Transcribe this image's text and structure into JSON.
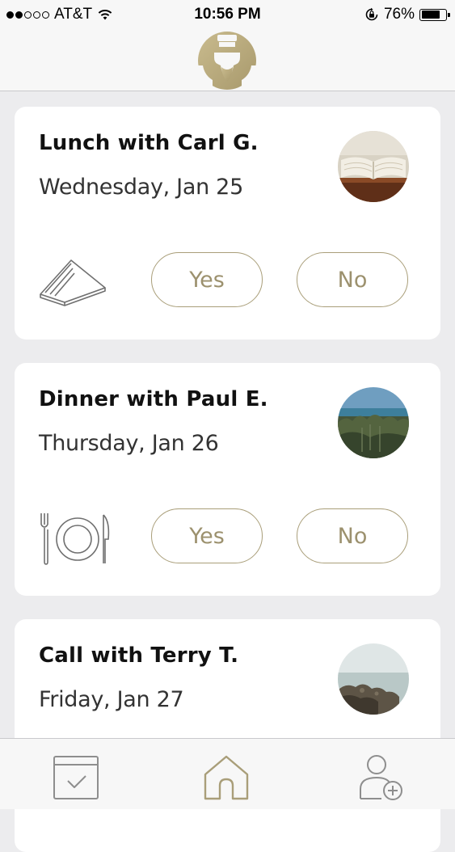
{
  "status_bar": {
    "carrier": "AT&T",
    "time": "10:56 PM",
    "battery": "76%",
    "battery_level": 0.76,
    "signal_bars": 2,
    "signal_total": 5,
    "icons": [
      "wifi-icon",
      "rotation-lock-icon",
      "battery-icon"
    ]
  },
  "header": {
    "logo_icon": "butler-logo",
    "logo_color": "#b4a67b"
  },
  "events": [
    {
      "title": "Lunch with Carl G.",
      "date": "Wednesday, Jan 25",
      "meal_icon": "sandwich-icon",
      "avatar": "book-photo",
      "yes_label": "Yes",
      "no_label": "No"
    },
    {
      "title": "Dinner with Paul E.",
      "date": "Thursday, Jan 26",
      "meal_icon": "plate-fork-knife-icon",
      "avatar": "coast-photo",
      "yes_label": "Yes",
      "no_label": "No"
    },
    {
      "title": "Call with Terry T.",
      "date": "Friday, Jan 27",
      "avatar": "rocks-sea-photo"
    }
  ],
  "tab_bar": {
    "tabs": [
      {
        "icon": "calendar-check-icon",
        "active": false
      },
      {
        "icon": "home-icon",
        "active": true
      },
      {
        "icon": "add-user-icon",
        "active": false
      }
    ]
  },
  "colors": {
    "accent": "#a99e79",
    "background": "#ececee",
    "card": "#ffffff"
  }
}
